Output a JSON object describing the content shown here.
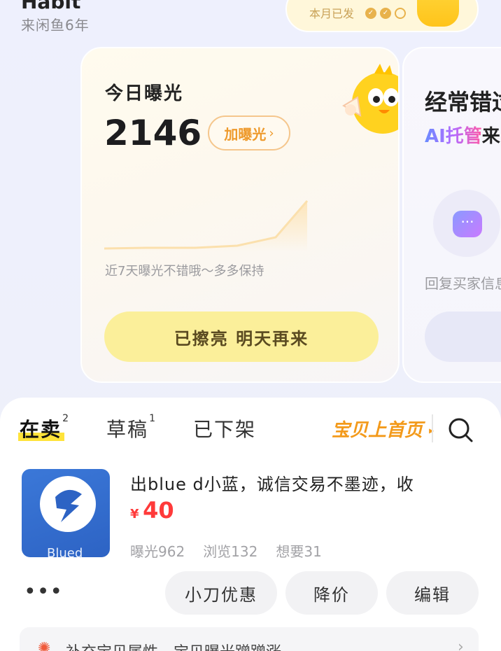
{
  "header": {
    "name": "Habit",
    "subtitle": "来闲鱼6年",
    "monthly": {
      "label": "本月已发",
      "checks_done": 2,
      "checks_total": 3
    }
  },
  "exposure_card": {
    "title": "今日曝光",
    "count": "2146",
    "boost_label": "加曝光",
    "boost_chevron": "›",
    "hint": "近7天曝光不错哦～多多保持",
    "status_button": "已擦亮  明天再来"
  },
  "ai_card": {
    "title": "经常错过",
    "sub_highlight": "AI托管",
    "sub_rest": "来",
    "bubble_glyph": "···",
    "hint": "回复买家信息"
  },
  "tabs": [
    {
      "label": "在卖",
      "count": "2"
    },
    {
      "label": "草稿",
      "count": "1"
    },
    {
      "label": "已下架",
      "count": ""
    }
  ],
  "promo": {
    "label": "宝贝上首页",
    "arrow": "▸"
  },
  "item": {
    "thumb_text": "Blued",
    "title": "出blue d小蓝，诚信交易不墨迹，收",
    "price_symbol": "¥",
    "price": "40",
    "stats": [
      "曝光962",
      "浏览132",
      "想要31"
    ]
  },
  "actions": {
    "more": "•••",
    "coupon": "小刀优惠",
    "reduce": "降价",
    "edit": "编辑"
  },
  "tip": {
    "icon": "✺",
    "text": "补充宝贝属性，宝贝曝光蹭蹭涨",
    "chevron": "›"
  },
  "colors": {
    "accent_orange": "#f39a1b",
    "price_red": "#ff3a3a",
    "status_yellow": "#fbef9a"
  }
}
